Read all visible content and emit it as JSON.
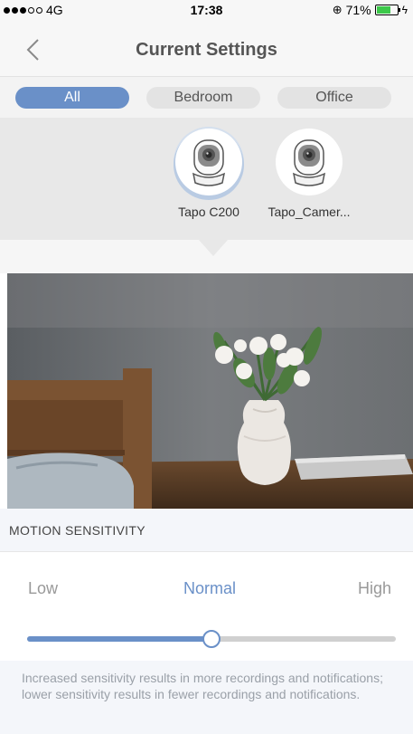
{
  "status_bar": {
    "carrier": "4G",
    "time": "17:38",
    "battery": "71%",
    "battery_level": 0.71
  },
  "nav": {
    "title": "Current Settings",
    "back_icon": "chevron-left-icon"
  },
  "tabs": [
    {
      "label": "All",
      "active": true
    },
    {
      "label": "Bedroom",
      "active": false
    },
    {
      "label": "Office",
      "active": false
    }
  ],
  "cameras": [
    {
      "name": "Tapo C200",
      "selected": true
    },
    {
      "name": "Tapo_Camer...",
      "selected": false
    }
  ],
  "motion": {
    "header": "MOTION SENSITIVITY",
    "low": "Low",
    "normal": "Normal",
    "high": "High",
    "value": 0.5,
    "note": "Increased sensitivity results in more recordings and notifications; lower sensitivity results in fewer recordings and notifications."
  },
  "colors": {
    "accent": "#6a90c8",
    "battery": "#3cc84a"
  }
}
